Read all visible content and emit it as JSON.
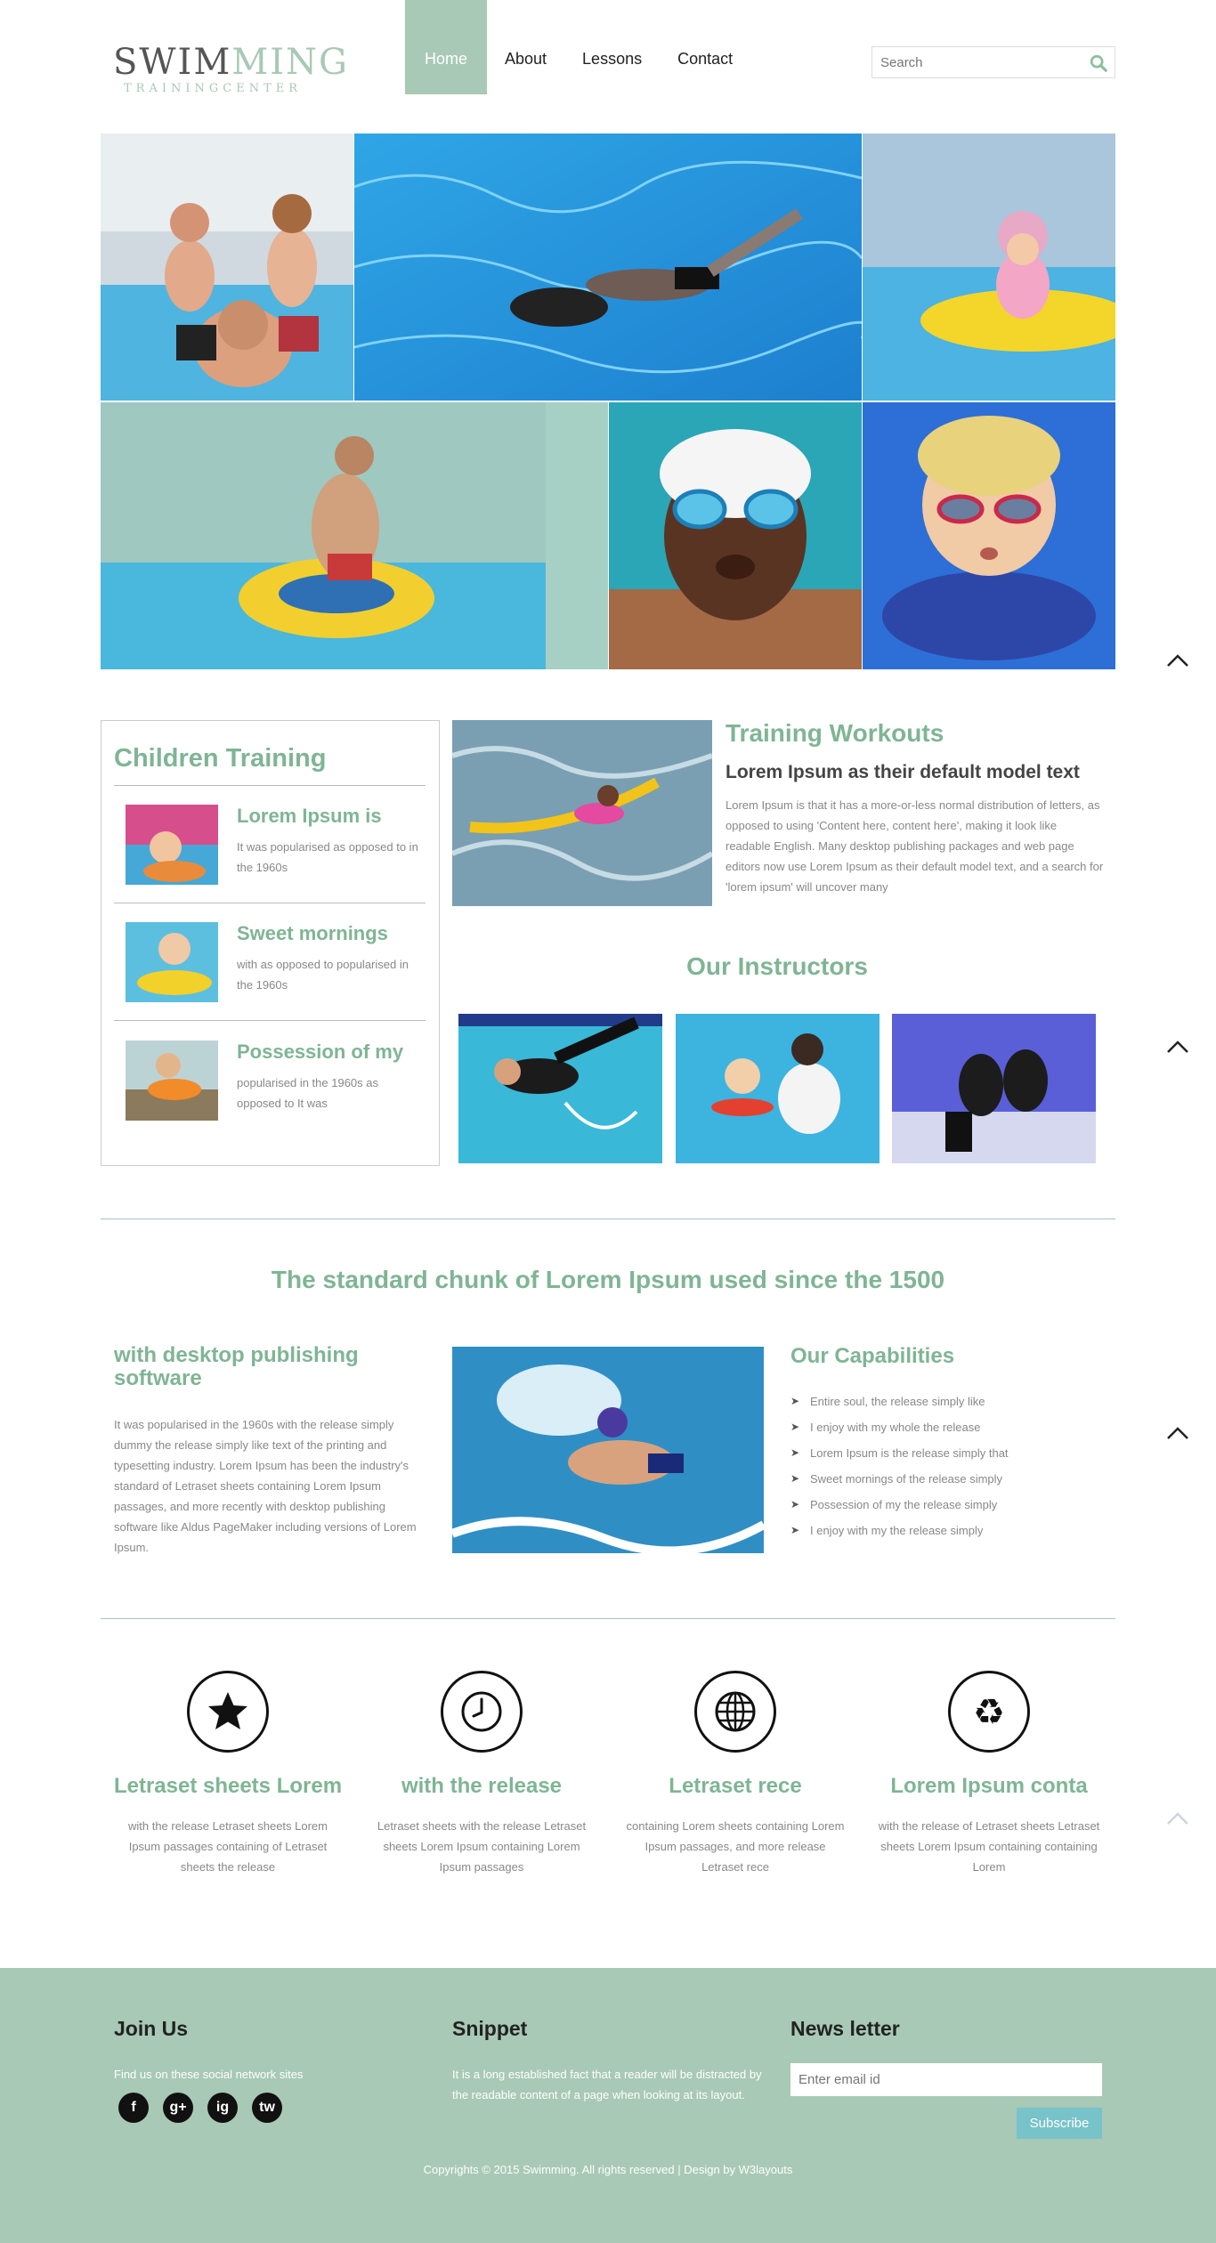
{
  "header": {
    "logo_main_dark": "SWIM",
    "logo_main_light": "MING",
    "logo_sub": "TRAININGCENTER",
    "nav": [
      "Home",
      "About",
      "Lessons",
      "Contact"
    ],
    "search_placeholder": "Search"
  },
  "children_training": {
    "title": "Children Training",
    "items": [
      {
        "title": "Lorem Ipsum is",
        "text": "It was popularised as opposed to in the 1960s"
      },
      {
        "title": "Sweet mornings",
        "text": "with as opposed to popularised in the 1960s"
      },
      {
        "title": "Possession of my",
        "text": "popularised in the 1960s as opposed to It was"
      }
    ]
  },
  "training_workouts": {
    "title": "Training Workouts",
    "subtitle": "Lorem Ipsum as their default model text",
    "text": "Lorem Ipsum is that it has a more-or-less normal distribution of letters, as opposed to using 'Content here, content here', making it look like readable English. Many desktop publishing packages and web page editors now use Lorem Ipsum as their default model text, and a search for 'lorem ipsum' will uncover many"
  },
  "instructors": {
    "title": "Our Instructors"
  },
  "standard": {
    "title": "The standard chunk of Lorem Ipsum used since the 1500",
    "left_title": "with desktop publishing software",
    "left_text": "It was popularised in the 1960s with the release simply dummy the release simply like text of the printing and typesetting industry. Lorem Ipsum has been the industry's standard of Letraset sheets containing Lorem Ipsum passages, and more recently with desktop publishing software like Aldus PageMaker including versions of Lorem Ipsum.",
    "capabilities_title": "Our Capabilities",
    "capabilities": [
      "Entire soul, the release simply like",
      "I enjoy with my whole the release",
      "Lorem Ipsum is the release simply that",
      "Sweet mornings of the release simply",
      "Possession of my the release simply",
      "I enjoy with my the release simply"
    ]
  },
  "features": [
    {
      "icon": "star-icon",
      "title": "Letraset sheets Lorem",
      "text": "with the release Letraset sheets Lorem Ipsum passages containing of Letraset sheets the release"
    },
    {
      "icon": "clock-icon",
      "title": "with the release",
      "text": "Letraset sheets with the release Letraset sheets Lorem Ipsum containing Lorem Ipsum passages"
    },
    {
      "icon": "globe-icon",
      "title": "Letraset rece",
      "text": "containing Lorem sheets containing Lorem Ipsum passages, and more release Letraset rece"
    },
    {
      "icon": "recycle-icon",
      "title": "Lorem Ipsum conta",
      "text": "with the release of Letraset sheets Letraset sheets Lorem Ipsum containing containing Lorem"
    }
  ],
  "footer": {
    "join_title": "Join Us",
    "join_text": "Find us on these social network sites",
    "social": [
      "f",
      "g+",
      "ig",
      "tw"
    ],
    "snippet_title": "Snippet",
    "snippet_text": "It is a long established fact that a reader will be distracted by the readable content of a page when looking at its layout.",
    "newsletter_title": "News letter",
    "email_placeholder": "Enter email id",
    "subscribe": "Subscribe",
    "copyright": "Copyrights © 2015 Swimming. All rights reserved | Design by W3layouts"
  },
  "colors": {
    "accent": "#7fb594",
    "brand": "#a8c9b5",
    "button": "#78c3c9"
  }
}
